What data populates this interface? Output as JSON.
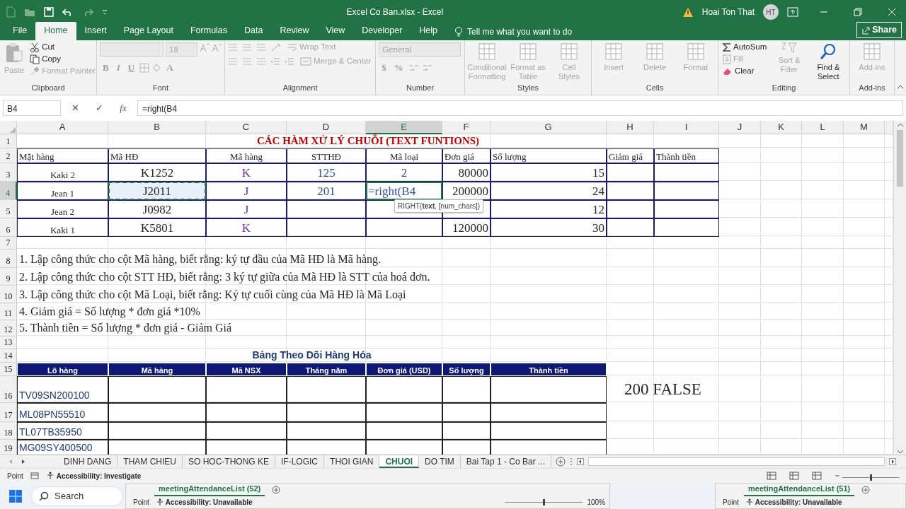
{
  "title_bar": {
    "title": "Excel Co Ban.xlsx  -  Excel",
    "user": "Hoai Ton That",
    "avatar": "HT"
  },
  "ribbon_tabs": [
    {
      "label": "File",
      "selected": false
    },
    {
      "label": "Home",
      "selected": true
    },
    {
      "label": "Insert",
      "selected": false
    },
    {
      "label": "Page Layout",
      "selected": false
    },
    {
      "label": "Formulas",
      "selected": false
    },
    {
      "label": "Data",
      "selected": false
    },
    {
      "label": "Review",
      "selected": false
    },
    {
      "label": "View",
      "selected": false
    },
    {
      "label": "Developer",
      "selected": false
    },
    {
      "label": "Help",
      "selected": false
    }
  ],
  "tell_me": "Tell me what you want to do",
  "share": "Share",
  "ribbon_groups": [
    {
      "name": "Clipboard",
      "kind": "clipboard",
      "commands": [
        {
          "label": "Paste",
          "disabled": true
        },
        {
          "label": "Cut",
          "disabled": false
        },
        {
          "label": "Copy",
          "disabled": false
        },
        {
          "label": "Format Painter",
          "disabled": true
        }
      ]
    },
    {
      "name": "Font",
      "kind": "font",
      "size": "18",
      "buttons": [
        "B",
        "I",
        "U",
        "A"
      ]
    },
    {
      "name": "Alignment",
      "kind": "alignment",
      "commands": [
        {
          "label": "Wrap Text",
          "disabled": true
        },
        {
          "label": "Merge & Center",
          "disabled": true
        }
      ]
    },
    {
      "name": "Number",
      "kind": "number",
      "format": "General",
      "symbols": [
        "$",
        "%"
      ]
    },
    {
      "name": "Styles",
      "kind": "big",
      "commands": [
        {
          "label": "Conditional Formatting",
          "disabled": true
        },
        {
          "label": "Format as Table",
          "disabled": true
        },
        {
          "label": "Cell Styles",
          "disabled": true
        }
      ]
    },
    {
      "name": "Cells",
      "kind": "big",
      "commands": [
        {
          "label": "Insert",
          "disabled": true
        },
        {
          "label": "Delete",
          "disabled": true
        },
        {
          "label": "Format",
          "disabled": true
        }
      ]
    },
    {
      "name": "Editing",
      "kind": "editing",
      "commands": [
        {
          "label": "AutoSum",
          "disabled": false
        },
        {
          "label": "Fill",
          "disabled": true
        },
        {
          "label": "Clear",
          "disabled": false
        },
        {
          "label": "Sort & Filter",
          "disabled": true
        },
        {
          "label": "Find & Select",
          "disabled": false
        }
      ]
    },
    {
      "name": "Add-ins",
      "kind": "big",
      "commands": [
        {
          "label": "Add-ins",
          "disabled": true
        }
      ]
    }
  ],
  "formula_bar": {
    "name_box": "B4",
    "buttons": [
      "✕",
      "✓",
      "fx"
    ],
    "formula": "=right(B4"
  },
  "sheet": {
    "columns": [
      {
        "label": "A",
        "selected": false
      },
      {
        "label": "B",
        "selected": false
      },
      {
        "label": "C",
        "selected": false
      },
      {
        "label": "D",
        "selected": false
      },
      {
        "label": "E",
        "selected": true
      },
      {
        "label": "F",
        "selected": false
      },
      {
        "label": "G",
        "selected": false
      },
      {
        "label": "H",
        "selected": false
      },
      {
        "label": "I",
        "selected": false
      },
      {
        "label": "J",
        "selected": false
      },
      {
        "label": "K",
        "selected": false
      },
      {
        "label": "L",
        "selected": false
      },
      {
        "label": "M",
        "selected": false
      }
    ],
    "rows": [
      {
        "header": "1",
        "selected": false,
        "kind": "plain",
        "cells": {
          "A": {
            "kind": "title",
            "text": "CÁC HÀM XỬ LÝ CHUỖI (TEXT FUNTIONS)"
          }
        }
      },
      {
        "header": "2",
        "selected": false,
        "kind": "table",
        "cells": {
          "A": {
            "kind": "label-left",
            "text": "Mặt hàng"
          },
          "B": {
            "kind": "label-left",
            "text": "Mã HĐ"
          },
          "C": {
            "kind": "label",
            "text": "Mã hàng"
          },
          "D": {
            "kind": "label",
            "text": "STTHĐ"
          },
          "E": {
            "kind": "label",
            "text": "Mã loại"
          },
          "F": {
            "kind": "label-left",
            "text": "Đơn giá"
          },
          "G": {
            "kind": "label-left",
            "text": "Số lượng"
          },
          "H": {
            "kind": "label-left",
            "text": "Giảm giá"
          },
          "I": {
            "kind": "label-left",
            "text": "Thành tiền"
          }
        }
      },
      {
        "header": "3",
        "selected": false,
        "kind": "table",
        "cells": {
          "A": {
            "kind": "name",
            "text": "Kaki 2"
          },
          "B": {
            "kind": "code",
            "text": "K1252"
          },
          "C": {
            "kind": "letter",
            "text": "K"
          },
          "D": {
            "kind": "digit",
            "text": "125"
          },
          "E": {
            "kind": "digit",
            "text": "2"
          },
          "F": {
            "kind": "number",
            "text": "80000"
          },
          "G": {
            "kind": "number",
            "text": "15"
          }
        }
      },
      {
        "header": "4",
        "selected": true,
        "kind": "table",
        "cells": {
          "A": {
            "kind": "name",
            "text": "Jean 1"
          },
          "B": {
            "kind": "code",
            "text": "J2011",
            "referenced": true
          },
          "C": {
            "kind": "letter",
            "text": "J"
          },
          "D": {
            "kind": "digit",
            "text": "201"
          },
          "E": {
            "kind": "formula",
            "text": "=right(B4",
            "editing": true
          },
          "F": {
            "kind": "number",
            "text": "200000"
          },
          "G": {
            "kind": "number",
            "text": "24"
          }
        }
      },
      {
        "header": "5",
        "selected": false,
        "kind": "table",
        "cells": {
          "A": {
            "kind": "name",
            "text": "Jean 2"
          },
          "B": {
            "kind": "code",
            "text": "J0982"
          },
          "C": {
            "kind": "letter",
            "text": "J"
          },
          "G": {
            "kind": "number",
            "text": "12"
          }
        }
      },
      {
        "header": "6",
        "selected": false,
        "kind": "table",
        "cells": {
          "A": {
            "kind": "name",
            "text": "Kaki 1"
          },
          "B": {
            "kind": "code",
            "text": "K5801"
          },
          "C": {
            "kind": "letter",
            "text": "K"
          },
          "F": {
            "kind": "number",
            "text": "120000"
          },
          "G": {
            "kind": "number",
            "text": "30"
          }
        }
      },
      {
        "header": "7",
        "selected": false,
        "kind": "plain"
      },
      {
        "header": "8",
        "selected": false,
        "kind": "plain",
        "cells": {
          "A": {
            "kind": "note",
            "text": "1. Lập công thức cho cột Mã hàng, biết rằng: ký tự đầu của Mã HĐ là Mã hàng."
          }
        }
      },
      {
        "header": "9",
        "selected": false,
        "kind": "plain",
        "cells": {
          "A": {
            "kind": "note",
            "text": "2. Lập công thức cho cột STT HĐ, biết rằng: 3 ký tự giữa của Mã HĐ là STT của hoá đơn."
          }
        }
      },
      {
        "header": "10",
        "selected": false,
        "kind": "plain",
        "cells": {
          "A": {
            "kind": "note",
            "text": "3. Lập công thức cho cột Mã Loại, biết rằng: Ký tự cuối cùng của Mã HĐ là Mã Loại"
          }
        }
      },
      {
        "header": "11",
        "selected": false,
        "kind": "plain",
        "cells": {
          "A": {
            "kind": "note",
            "text": "4. Giảm giá = Số lượng * đơn giá *10%"
          }
        }
      },
      {
        "header": "12",
        "selected": false,
        "kind": "plain",
        "cells": {
          "A": {
            "kind": "note",
            "text": "5. Thành tiền = Số lượng * đơn giá - Giảm Giá"
          }
        }
      },
      {
        "header": "13",
        "selected": false,
        "kind": "plain"
      },
      {
        "header": "14",
        "selected": false,
        "kind": "plain",
        "cells": {
          "A": {
            "kind": "band-title",
            "text": "Bảng Theo Dõi Hàng Hóa"
          }
        }
      },
      {
        "header": "15",
        "selected": false,
        "kind": "band-header",
        "cells": {
          "A": {
            "kind": "band-label",
            "text": "Lô hàng"
          },
          "B": {
            "kind": "band-label",
            "text": "Mã hàng"
          },
          "C": {
            "kind": "band-label",
            "text": "Mã NSX"
          },
          "D": {
            "kind": "band-label",
            "text": "Tháng năm"
          },
          "E": {
            "kind": "band-label",
            "text": "Đơn giá (USD)"
          },
          "F": {
            "kind": "band-label",
            "text": "Số lượng"
          },
          "G": {
            "kind": "band-label",
            "text": "Thành tiền"
          }
        }
      },
      {
        "header": "16",
        "selected": false,
        "kind": "band",
        "cells": {
          "A": {
            "kind": "lot",
            "text": "TV09SN200100"
          },
          "H": {
            "kind": "result",
            "text": "200 FALSE"
          }
        }
      },
      {
        "header": "17",
        "selected": false,
        "kind": "band",
        "cells": {
          "A": {
            "kind": "lot",
            "text": "ML08PN55510"
          }
        }
      },
      {
        "header": "18",
        "selected": false,
        "kind": "band",
        "cells": {
          "A": {
            "kind": "lot",
            "text": "TL07TB35950"
          }
        }
      },
      {
        "header": "19",
        "selected": false,
        "kind": "band",
        "cells": {
          "A": {
            "kind": "lot",
            "text": "MG09SY400500"
          }
        }
      }
    ],
    "tooltip": "RIGHT(**text**, [num_chars])"
  },
  "sheet_tabs": [
    {
      "label": "DINH DANG",
      "selected": false
    },
    {
      "label": "THAM CHIEU",
      "selected": false
    },
    {
      "label": "SO HOC-THONG KE",
      "selected": false
    },
    {
      "label": "IF-LOGIC",
      "selected": false
    },
    {
      "label": "THOI GIAN",
      "selected": false
    },
    {
      "label": "CHUOI",
      "selected": true
    },
    {
      "label": "DO TIM",
      "selected": false
    },
    {
      "label": "Bai Tap 1 - Co Bar ...",
      "selected": false
    }
  ],
  "status_bar": {
    "mode": "Point",
    "accessibility": "Accessibility: Investigate",
    "zoom_slider": {
      "level": 0.5
    }
  },
  "taskbar": {
    "search": "Search",
    "windows": [
      {
        "title": "meetingAttendanceList (52)",
        "mode": "Point",
        "accessibility": "Accessibility: Unavailable",
        "zoom_slider": {
          "level": 0.5
        },
        "zoom": "100%"
      },
      {
        "title": "meetingAttendanceList (51)",
        "mode": "Point",
        "accessibility": "Accessibility: Unavailable"
      }
    ]
  }
}
